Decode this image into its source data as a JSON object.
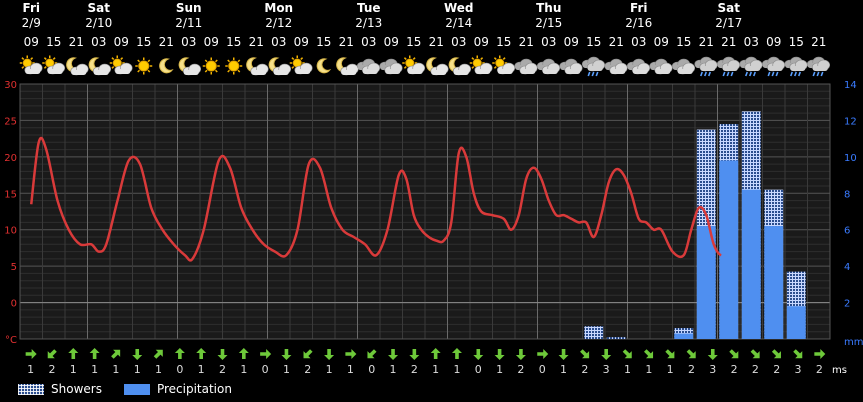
{
  "days": [
    {
      "name": "Fri",
      "date": "2/9",
      "slot": 0
    },
    {
      "name": "Sat",
      "date": "2/10",
      "slot": 3
    },
    {
      "name": "Sun",
      "date": "2/11",
      "slot": 7
    },
    {
      "name": "Mon",
      "date": "2/12",
      "slot": 11
    },
    {
      "name": "Tue",
      "date": "2/13",
      "slot": 15
    },
    {
      "name": "Wed",
      "date": "2/14",
      "slot": 19
    },
    {
      "name": "Thu",
      "date": "2/15",
      "slot": 23
    },
    {
      "name": "Fri",
      "date": "2/16",
      "slot": 27
    },
    {
      "name": "Sat",
      "date": "2/17",
      "slot": 31
    }
  ],
  "hours": [
    "09",
    "15",
    "21",
    "03",
    "09",
    "15",
    "21",
    "03",
    "09",
    "15",
    "21",
    "03",
    "09",
    "15",
    "21",
    "03",
    "09",
    "15",
    "21",
    "03",
    "09",
    "15",
    "21",
    "03",
    "09",
    "15",
    "21",
    "03",
    "09",
    "15",
    "21",
    "21",
    "03",
    "09",
    "15",
    "21"
  ],
  "icons": [
    "sun-cloud",
    "sun-cloud",
    "moon-cloud",
    "moon-cloud",
    "sun-cloud",
    "sun",
    "moon",
    "moon-cloud",
    "sun",
    "sun",
    "moon-cloud",
    "moon-cloud",
    "sun-cloud",
    "moon",
    "moon-cloud",
    "cloud",
    "cloud",
    "sun-cloud",
    "moon-cloud",
    "moon-cloud",
    "sun-cloud",
    "sun-cloud",
    "cloud",
    "cloud",
    "cloud",
    "cloud-rain",
    "cloud",
    "cloud",
    "cloud",
    "cloud",
    "cloud-rain",
    "cloud-rain",
    "cloud-rain",
    "cloud-rain",
    "cloud-rain",
    "cloud-rain"
  ],
  "wind": [
    {
      "dir": "right",
      "speed": "1"
    },
    {
      "dir": "down-left",
      "speed": "2"
    },
    {
      "dir": "up",
      "speed": "1"
    },
    {
      "dir": "up",
      "speed": "1"
    },
    {
      "dir": "up-right",
      "speed": "1"
    },
    {
      "dir": "down",
      "speed": "1"
    },
    {
      "dir": "up-right",
      "speed": "1"
    },
    {
      "dir": "up",
      "speed": "0"
    },
    {
      "dir": "up",
      "speed": "1"
    },
    {
      "dir": "down",
      "speed": "2"
    },
    {
      "dir": "up",
      "speed": "1"
    },
    {
      "dir": "right",
      "speed": "0"
    },
    {
      "dir": "down",
      "speed": "1"
    },
    {
      "dir": "down-left",
      "speed": "2"
    },
    {
      "dir": "down",
      "speed": "1"
    },
    {
      "dir": "right",
      "speed": "1"
    },
    {
      "dir": "down-left",
      "speed": "0"
    },
    {
      "dir": "down",
      "speed": "1"
    },
    {
      "dir": "down",
      "speed": "2"
    },
    {
      "dir": "up",
      "speed": "1"
    },
    {
      "dir": "up",
      "speed": "1"
    },
    {
      "dir": "down",
      "speed": "0"
    },
    {
      "dir": "down",
      "speed": "1"
    },
    {
      "dir": "down",
      "speed": "2"
    },
    {
      "dir": "right",
      "speed": "0"
    },
    {
      "dir": "down",
      "speed": "1"
    },
    {
      "dir": "down-right",
      "speed": "2"
    },
    {
      "dir": "down",
      "speed": "3"
    },
    {
      "dir": "down-right",
      "speed": "1"
    },
    {
      "dir": "down-right",
      "speed": "1"
    },
    {
      "dir": "down-right",
      "speed": "1"
    },
    {
      "dir": "down-right",
      "speed": "2"
    },
    {
      "dir": "down",
      "speed": "3"
    },
    {
      "dir": "down-right",
      "speed": "2"
    },
    {
      "dir": "down-right",
      "speed": "2"
    },
    {
      "dir": "down-right",
      "speed": "2"
    },
    {
      "dir": "down-right",
      "speed": "3"
    },
    {
      "dir": "right",
      "speed": "2"
    }
  ],
  "wind_unit": "ms",
  "units": {
    "left": "°C",
    "right": "mm"
  },
  "legend": [
    {
      "label": "Showers",
      "kind": "showers"
    },
    {
      "label": "Precipitation",
      "kind": "precip"
    }
  ],
  "colors": {
    "temperature": "#d93a3a",
    "precipitation": "#4f8ff0",
    "showers": "#2a4d8e",
    "grid": "#444444",
    "wind_arrow": "#6ec93a"
  },
  "chart_data": {
    "type": "line",
    "x_unit": "hours from Fri 2/9 09:00",
    "temperature": {
      "x": [
        0,
        2,
        4,
        7,
        10,
        13,
        16,
        18,
        20,
        23,
        26,
        29,
        32,
        35,
        38,
        41,
        43,
        46,
        50,
        53,
        56,
        59,
        62,
        65,
        68,
        71,
        74,
        77,
        80,
        83,
        86,
        89,
        92,
        95,
        98,
        100,
        102,
        104,
        106,
        108,
        110,
        112,
        114,
        116,
        118,
        120,
        123,
        126,
        128,
        130,
        132,
        134,
        136,
        138,
        140,
        142,
        144,
        146,
        148,
        150,
        152,
        154,
        156,
        158,
        160,
        162,
        164,
        166,
        168,
        171,
        174,
        176,
        178,
        180,
        182,
        184,
        186,
        188,
        190,
        192,
        194,
        196,
        198,
        200,
        202,
        204
      ],
      "y": [
        13.5,
        22,
        21,
        14,
        10,
        8,
        8,
        7,
        8,
        14,
        19.5,
        19,
        13,
        10,
        8,
        6.5,
        6,
        10,
        19.5,
        18.5,
        13,
        10,
        8,
        7,
        6.5,
        10,
        19,
        18.5,
        13,
        10,
        9,
        8,
        6.5,
        10,
        17.5,
        17,
        12,
        10,
        9,
        8.5,
        8.5,
        11,
        20.5,
        20,
        15,
        12.5,
        12,
        11.5,
        10,
        12,
        17,
        18.5,
        17,
        14,
        12,
        12,
        11.5,
        11,
        11,
        9,
        12,
        16.5,
        18.3,
        17.5,
        15,
        11.5,
        11,
        10,
        10,
        7,
        6.5,
        10,
        13,
        12,
        8,
        6.5,
        7.5
      ],
      "ylim": [
        -5,
        30
      ],
      "yticks": [
        -5,
        0,
        5,
        10,
        15,
        20,
        25,
        30
      ],
      "yticklabels": [
        "°C",
        "0",
        "5",
        "10",
        "15",
        "20",
        "25",
        "30"
      ]
    },
    "precipitation": {
      "type": "bar",
      "ylim": [
        0,
        14
      ],
      "yticks": [
        0,
        2,
        4,
        6,
        8,
        10,
        12,
        14
      ],
      "yticklabels": [
        "mm",
        "2",
        "4",
        "6",
        "8",
        "10",
        "12",
        "14"
      ],
      "slots": [
        25,
        26,
        28,
        29,
        30,
        31,
        32,
        33,
        34
      ],
      "precip": [
        0,
        0,
        0,
        0,
        0.3,
        6.2,
        9.8,
        8.2,
        6.2,
        1.8
      ],
      "showers": [
        0.7,
        0.1,
        0,
        0,
        0.6,
        11.5,
        11.8,
        12.5,
        8.2,
        3.7
      ]
    }
  }
}
